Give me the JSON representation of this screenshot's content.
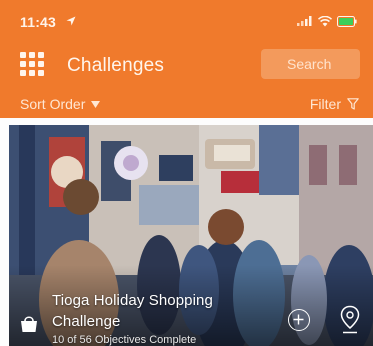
{
  "status_bar": {
    "time": "11:43",
    "icons": [
      "location-arrow-icon",
      "signal-icon",
      "wifi-icon",
      "battery-icon"
    ]
  },
  "header": {
    "menu_icon": "grid-icon",
    "title": "Challenges",
    "search_label": "Search"
  },
  "filter_bar": {
    "sort_label": "Sort Order",
    "sort_icon": "caret-down-icon",
    "filter_label": "Filter",
    "filter_icon": "funnel-icon"
  },
  "challenges": [
    {
      "title_line_1": "Tioga Holiday Shopping",
      "title_line_2": "Challenge",
      "progress": "10 of 56 Objectives Complete",
      "category_icon": "shopping-bag-icon",
      "actions": [
        "add-icon",
        "map-pin-icon"
      ]
    }
  ],
  "colors": {
    "header_orange": "#f07a2c",
    "search_button": "#f39a5c",
    "header_text": "#fff5ec"
  }
}
